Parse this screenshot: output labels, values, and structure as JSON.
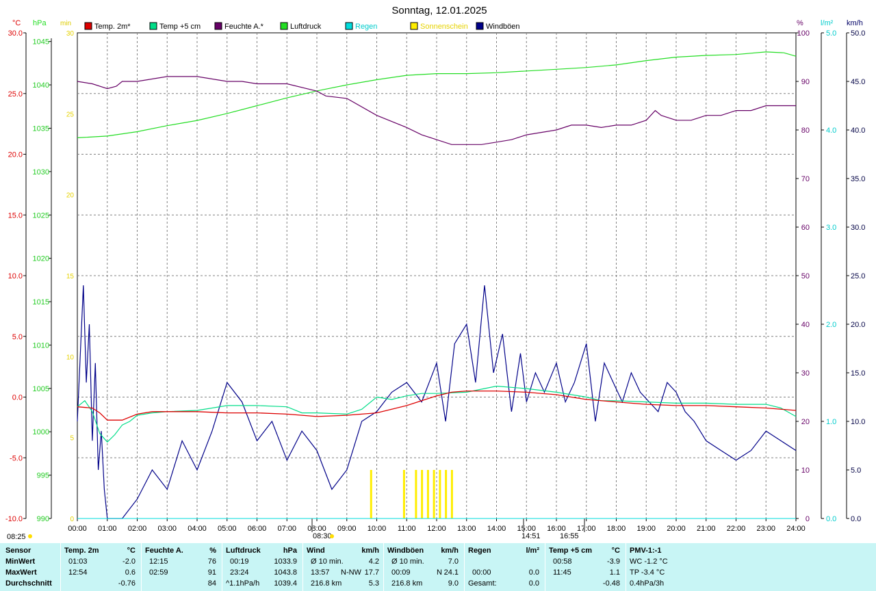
{
  "title": "Sonntag, 12.01.2025",
  "axes": {
    "left_units": {
      "temp": "°C",
      "pressure": "hPa",
      "sun": "min"
    },
    "right_units": {
      "humidity": "%",
      "rain": "l/m²",
      "wind": "km/h"
    },
    "temp_ticks": [
      "30.0",
      "25.0",
      "20.0",
      "15.0",
      "10.0",
      "5.0",
      "0.0",
      "-5.0",
      "-10.0"
    ],
    "pressure_ticks": [
      "1045",
      "1040",
      "1035",
      "1030",
      "1025",
      "1020",
      "1015",
      "1010",
      "1005",
      "1000",
      "995",
      "990"
    ],
    "sun_ticks": [
      "30",
      "25",
      "20",
      "15",
      "10",
      "5",
      "0"
    ],
    "humidity_ticks": [
      "100",
      "90",
      "80",
      "70",
      "60",
      "50",
      "40",
      "30",
      "20",
      "10",
      "0"
    ],
    "rain_ticks": [
      "5.0",
      "4.0",
      "3.0",
      "2.0",
      "1.0",
      "0.0"
    ],
    "wind_ticks": [
      "50.0",
      "45.0",
      "40.0",
      "35.0",
      "30.0",
      "25.0",
      "20.0",
      "15.0",
      "10.0",
      "5.0",
      "0.0"
    ],
    "time_ticks": [
      "00:00",
      "01:00",
      "02:00",
      "03:00",
      "04:00",
      "05:00",
      "06:00",
      "07:00",
      "08:00",
      "09:00",
      "10:00",
      "11:00",
      "12:00",
      "13:00",
      "14:00",
      "15:00",
      "16:00",
      "17:00",
      "18:00",
      "19:00",
      "20:00",
      "21:00",
      "22:00",
      "23:00",
      "24:00"
    ]
  },
  "sun_events": {
    "sunrise_marker": "08:25",
    "events": [
      "08:30",
      "14:51",
      "16:55"
    ]
  },
  "colors": {
    "temp": "#dd0000",
    "temp5": "#00dd88",
    "humidity": "#660066",
    "pressure": "#22dd22",
    "rain": "#00dddd",
    "sun": "#ffee00",
    "wind": "#000088",
    "footer_bg": "#c8f5f5"
  },
  "chart_data": {
    "type": "line",
    "title": "Sonntag, 12.01.2025",
    "x_unit": "hour",
    "xlim": [
      0,
      24
    ],
    "legend": [
      "Temp. 2m*",
      "Temp +5 cm",
      "Feuchte A.*",
      "Luftdruck",
      "Regen",
      "Sonnenschein",
      "Windböen"
    ],
    "legend_placement": "top",
    "grid": true,
    "series": [
      {
        "name": "Temp. 2m*",
        "axis": "°C",
        "ylim": [
          -10,
          30
        ],
        "x": [
          0,
          0.5,
          0.75,
          1,
          1.5,
          2,
          2.5,
          3,
          4,
          5,
          6,
          7,
          8,
          9,
          10,
          11,
          12,
          12.5,
          13,
          14,
          15,
          16,
          17,
          18,
          19,
          20,
          21,
          22,
          23,
          24
        ],
        "y": [
          -0.8,
          -0.9,
          -1.3,
          -1.9,
          -1.9,
          -1.4,
          -1.2,
          -1.2,
          -1.2,
          -1.3,
          -1.3,
          -1.4,
          -1.6,
          -1.5,
          -1.3,
          -0.7,
          0.1,
          0.4,
          0.5,
          0.5,
          0.4,
          0.2,
          -0.2,
          -0.4,
          -0.6,
          -0.7,
          -0.7,
          -0.8,
          -0.9,
          -1.1
        ]
      },
      {
        "name": "Temp +5 cm",
        "axis": "°C",
        "ylim": [
          -10,
          30
        ],
        "x": [
          0,
          0.25,
          0.5,
          0.75,
          1,
          1.25,
          1.5,
          1.75,
          2,
          2.5,
          3,
          4,
          4.5,
          5,
          6,
          7,
          7.5,
          8,
          9,
          9.5,
          10,
          10.5,
          11,
          11.5,
          12,
          13,
          14,
          15,
          16,
          17,
          17.5,
          18,
          19,
          20,
          21,
          22,
          23,
          23.5,
          24
        ],
        "y": [
          -0.8,
          -0.3,
          -1.2,
          -3.0,
          -3.7,
          -3.1,
          -2.3,
          -2.0,
          -1.5,
          -1.3,
          -1.2,
          -1.1,
          -0.9,
          -0.7,
          -0.7,
          -0.8,
          -1.3,
          -1.3,
          -1.4,
          -1.0,
          0.0,
          -0.2,
          0.1,
          0.3,
          0.3,
          0.4,
          0.9,
          0.7,
          0.4,
          0.0,
          -0.3,
          -0.3,
          -0.4,
          -0.5,
          -0.5,
          -0.6,
          -0.6,
          -0.9,
          -1.6
        ]
      },
      {
        "name": "Feuchte A.*",
        "axis": "%",
        "ylim": [
          0,
          100
        ],
        "x": [
          0,
          0.5,
          1,
          1.3,
          1.5,
          2,
          3,
          4,
          5,
          5.5,
          6,
          7,
          8,
          8.3,
          9,
          10,
          11,
          11.5,
          12,
          12.5,
          13,
          13.5,
          14,
          14.5,
          15,
          16,
          16.5,
          17,
          17.5,
          18,
          18.5,
          19,
          19.3,
          19.5,
          20,
          20.5,
          21,
          21.5,
          22,
          22.5,
          23,
          23.5,
          24
        ],
        "y": [
          90,
          89.5,
          88.5,
          89,
          90,
          90,
          91,
          91,
          90,
          90,
          89.5,
          89.5,
          88,
          87,
          86.5,
          83,
          80.5,
          79,
          78,
          77,
          77,
          77,
          77.5,
          78,
          79,
          80,
          81,
          81,
          80.5,
          81,
          81,
          82,
          84,
          83,
          82,
          82,
          83,
          83,
          84,
          84,
          85,
          85,
          85
        ]
      },
      {
        "name": "Luftdruck",
        "axis": "hPa",
        "ylim": [
          990,
          1046
        ],
        "x": [
          0,
          1,
          2,
          3,
          4,
          5,
          6,
          7,
          8,
          9,
          10,
          11,
          12,
          13,
          14,
          15,
          16,
          17,
          18,
          19,
          20,
          21,
          22,
          23,
          23.6,
          24
        ],
        "y": [
          1033.9,
          1034.1,
          1034.6,
          1035.3,
          1035.9,
          1036.7,
          1037.6,
          1038.5,
          1039.3,
          1040.0,
          1040.6,
          1041.1,
          1041.3,
          1041.3,
          1041.4,
          1041.6,
          1041.8,
          1042.0,
          1042.3,
          1042.8,
          1043.2,
          1043.4,
          1043.5,
          1043.8,
          1043.7,
          1043.3
        ]
      },
      {
        "name": "Windböen",
        "axis": "km/h",
        "ylim": [
          0,
          50
        ],
        "x": [
          0,
          0.1,
          0.2,
          0.3,
          0.4,
          0.5,
          0.6,
          0.7,
          0.8,
          0.9,
          1.0,
          1.2,
          1.5,
          2,
          2.5,
          3,
          3.5,
          4,
          4.5,
          5,
          5.5,
          6,
          6.5,
          7,
          7.5,
          8,
          8.5,
          9,
          9.5,
          10,
          10.5,
          11,
          11.5,
          12,
          12.3,
          12.6,
          13,
          13.3,
          13.6,
          13.9,
          14.2,
          14.5,
          14.8,
          15,
          15.3,
          15.6,
          16,
          16.3,
          16.6,
          17,
          17.3,
          17.6,
          17.9,
          18.2,
          18.5,
          18.8,
          19.1,
          19.4,
          19.7,
          20,
          20.3,
          20.6,
          21,
          21.5,
          22,
          22.5,
          23,
          23.5,
          24
        ],
        "y": [
          10,
          17,
          24,
          14,
          20,
          8,
          16,
          5,
          9,
          3,
          0,
          0,
          0,
          2,
          5,
          3,
          8,
          5,
          9,
          14,
          12,
          8,
          10,
          6,
          9,
          7,
          3,
          5,
          10,
          11,
          13,
          14,
          12,
          16,
          10,
          18,
          20,
          14,
          24,
          15,
          19,
          11,
          17,
          12,
          15,
          13,
          16,
          12,
          14,
          18,
          10,
          16,
          14,
          12,
          15,
          13,
          12,
          11,
          14,
          13,
          11,
          10,
          8,
          7,
          6,
          7,
          9,
          8,
          7
        ]
      },
      {
        "name": "Sonnenschein",
        "axis": "min",
        "ylim": [
          0,
          30
        ],
        "x": [
          9.8,
          10.9,
          11.3,
          11.5,
          11.7,
          11.9,
          12.1,
          12.3,
          12.5
        ],
        "y": [
          3,
          3,
          3,
          3,
          3,
          3,
          3,
          3,
          3
        ]
      },
      {
        "name": "Regen",
        "axis": "l/m²",
        "ylim": [
          0,
          5
        ],
        "x": [
          0,
          24
        ],
        "y": [
          0,
          0
        ]
      }
    ]
  },
  "footer": {
    "sensor": {
      "header": "Sensor",
      "min": "MinWert",
      "max": "MaxWert",
      "avg": "Durchschnitt"
    },
    "temp": {
      "header": "Temp. 2m",
      "unit": "°C",
      "min_time": "01:03",
      "min_val": "-2.0",
      "max_time": "12:54",
      "max_val": "0.6",
      "avg_val": "-0.76"
    },
    "humidity": {
      "header": "Feuchte A.",
      "unit": "%",
      "min_time": "12:15",
      "min_val": "76",
      "max_time": "02:59",
      "max_val": "91",
      "avg_val": "84"
    },
    "pressure": {
      "header": "Luftdruck",
      "unit": "hPa",
      "min_time": "00:19",
      "min_val": "1033.9",
      "max_time": "23:24",
      "max_val": "1043.8",
      "avg_label": "^1.1hPa/h",
      "avg_val": "1039.4"
    },
    "wind": {
      "header": "Wind",
      "unit": "km/h",
      "min_label": "Ø 10 min.",
      "min_val": "4.2",
      "max_time": "13:57",
      "max_dir": "N-NW",
      "max_val": "17.7",
      "avg_label": "216.8 km",
      "avg_val": "5.3"
    },
    "gusts": {
      "header": "Windböen",
      "unit": "km/h",
      "min_label": "Ø 10 min.",
      "min_val": "7.0",
      "max_time": "00:09",
      "max_dir": "N",
      "max_val": "24.1",
      "avg_label": "216.8 km",
      "avg_val": "9.0"
    },
    "rain": {
      "header": "Regen",
      "unit": "l/m²",
      "max_time": "00:00",
      "max_val": "0.0",
      "avg_label": "Gesamt:",
      "avg_val": "0.0"
    },
    "temp5": {
      "header": "Temp +5 cm",
      "unit": "°C",
      "min_time": "00:58",
      "min_val": "-3.9",
      "max_time": "11:45",
      "max_val": "1.1",
      "avg_val": "-0.48"
    },
    "pmv": {
      "header": "PMV-1:-1",
      "min_val": "WC -1.2 °C",
      "max_val": "TP -3.4 °C",
      "avg_val": "0.4hPa/3h"
    }
  }
}
